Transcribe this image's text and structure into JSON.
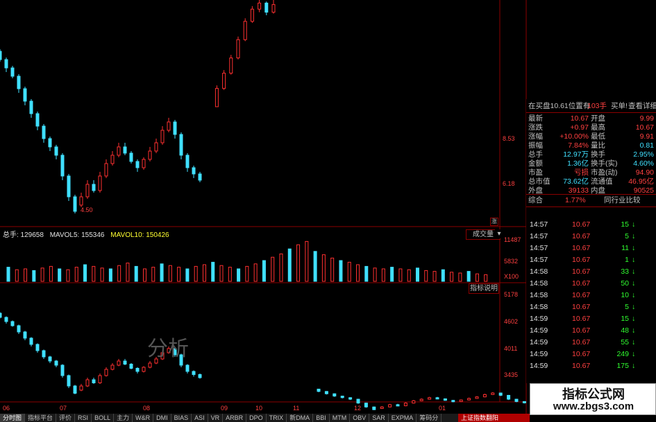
{
  "chart_data": {
    "type": "candlestick",
    "price_ticks": [
      "8.53",
      "6.18"
    ],
    "price_low_label": "4.50",
    "ind_ticks": [
      "5178",
      "4602",
      "4011",
      "3435"
    ],
    "vol_ticks": [
      "11487",
      "5832",
      "X100"
    ],
    "x_labels": [
      "06",
      "07",
      "08",
      "09",
      "10",
      "11",
      "12",
      "01"
    ],
    "colors": {
      "up": "#ff3030",
      "down": "#40e0ff",
      "ma5": "#ffffff",
      "ma10": "#ffd700",
      "grid": "#8b0000"
    },
    "price_candles": [
      [
        0.11,
        0.8,
        0.82,
        0.79,
        0.85
      ],
      [
        0.13,
        0.82,
        0.85,
        0.81,
        0.87
      ],
      [
        0.16,
        0.85,
        0.88,
        0.84,
        0.9
      ],
      [
        0.19,
        0.88,
        0.86,
        0.85,
        0.89
      ],
      [
        0.22,
        0.86,
        0.82,
        0.8,
        0.87
      ],
      [
        0.25,
        0.82,
        0.78,
        0.77,
        0.83
      ],
      [
        0.28,
        0.78,
        0.74,
        0.72,
        0.79
      ],
      [
        0.31,
        0.74,
        0.7,
        0.69,
        0.75
      ],
      [
        0.34,
        0.7,
        0.64,
        0.62,
        0.71
      ],
      [
        0.37,
        0.64,
        0.58,
        0.56,
        0.65
      ],
      [
        0.4,
        0.58,
        0.52,
        0.5,
        0.59
      ],
      [
        0.43,
        0.52,
        0.46,
        0.44,
        0.53
      ],
      [
        0.46,
        0.46,
        0.4,
        0.38,
        0.47
      ],
      [
        0.49,
        0.4,
        0.36,
        0.34,
        0.41
      ],
      [
        0.52,
        0.36,
        0.32,
        0.3,
        0.37
      ],
      [
        0.55,
        0.32,
        0.22,
        0.2,
        0.33
      ],
      [
        0.58,
        0.22,
        0.12,
        0.1,
        0.23
      ],
      [
        0.61,
        0.12,
        0.05,
        0.04,
        0.13
      ],
      [
        0.64,
        0.08,
        0.12,
        0.07,
        0.14
      ],
      [
        0.67,
        0.12,
        0.18,
        0.11,
        0.2
      ],
      [
        0.7,
        0.18,
        0.15,
        0.14,
        0.2
      ],
      [
        0.73,
        0.15,
        0.22,
        0.14,
        0.24
      ],
      [
        0.76,
        0.22,
        0.28,
        0.21,
        0.3
      ],
      [
        0.79,
        0.28,
        0.32,
        0.27,
        0.34
      ],
      [
        0.82,
        0.32,
        0.36,
        0.31,
        0.38
      ],
      [
        0.85,
        0.36,
        0.33,
        0.32,
        0.38
      ],
      [
        0.88,
        0.33,
        0.29,
        0.28,
        0.34
      ],
      [
        0.91,
        0.29,
        0.26,
        0.24,
        0.3
      ],
      [
        0.94,
        0.26,
        0.3,
        0.25,
        0.31
      ],
      [
        0.97,
        0.3,
        0.34,
        0.29,
        0.36
      ],
      [
        1.0,
        0.34,
        0.38,
        0.33,
        0.4
      ],
      [
        1.03,
        0.38,
        0.44,
        0.37,
        0.46
      ],
      [
        1.06,
        0.44,
        0.48,
        0.43,
        0.5
      ],
      [
        1.09,
        0.48,
        0.42,
        0.4,
        0.49
      ],
      [
        1.12,
        0.42,
        0.32,
        0.3,
        0.43
      ],
      [
        1.15,
        0.32,
        0.26,
        0.24,
        0.33
      ],
      [
        1.18,
        0.26,
        0.23,
        0.21,
        0.27
      ],
      [
        1.21,
        0.23,
        0.2,
        0.19,
        0.24
      ]
    ],
    "tail_candles": [
      [
        1.36,
        0.3,
        0.42,
        0.3,
        0.44
      ],
      [
        1.39,
        0.42,
        0.52,
        0.41,
        0.54
      ],
      [
        1.42,
        0.52,
        0.62,
        0.51,
        0.64
      ],
      [
        1.45,
        0.62,
        0.74,
        0.61,
        0.76
      ],
      [
        1.48,
        0.74,
        0.86,
        0.73,
        0.88
      ],
      [
        1.51,
        0.86,
        0.94,
        0.85,
        0.96
      ],
      [
        1.54,
        0.94,
        0.98,
        0.92,
        1.0
      ],
      [
        1.57,
        0.98,
        0.92,
        0.9,
        0.99
      ],
      [
        1.6,
        0.92,
        0.97,
        0.91,
        1.0
      ]
    ],
    "volume_bars": [
      0.34,
      0.28,
      0.3,
      0.26,
      0.32,
      0.36,
      0.3,
      0.28,
      0.34,
      0.4,
      0.36,
      0.32,
      0.3,
      0.38,
      0.44,
      0.36,
      0.3,
      0.34,
      0.42,
      0.38,
      0.34,
      0.3,
      0.36,
      0.4,
      0.46,
      0.38,
      0.34,
      0.3,
      0.36,
      0.42,
      0.5,
      0.58,
      0.66,
      0.78,
      0.88,
      0.96,
      0.72,
      0.64,
      0.56,
      0.5,
      0.46,
      0.4,
      0.36,
      0.32,
      0.3,
      0.34,
      0.3,
      0.28,
      0.32,
      0.26,
      0.24,
      0.28,
      0.22,
      0.2,
      0.24,
      0.18,
      0.16
    ]
  },
  "volume_header": {
    "total": "总手: 129658",
    "ma5": "MAVOL5: 155346",
    "ma10": "MAVOL10: 150426"
  },
  "chart_buttons": {
    "volume": "成交量",
    "indicator": "指标说明",
    "rise_flag": "涨"
  },
  "watermark": "分析",
  "quote_panel": {
    "header": {
      "bid": "在买盘10.61位置有",
      "qty": "103手",
      "buy1": "买单!",
      "detail": "查看详细"
    },
    "rows": [
      {
        "l1": "最新",
        "v1": "10.67",
        "l2": "开盘",
        "v2": "9.99"
      },
      {
        "l1": "涨跌",
        "v1": "+0.97",
        "l2": "最高",
        "v2": "10.67"
      },
      {
        "l1": "涨幅",
        "v1": "+10.00%",
        "l2": "最低",
        "v2": "9.91"
      },
      {
        "l1": "振幅",
        "v1": "7.84%",
        "l2": "量比",
        "v2": "0.81"
      },
      {
        "l1": "总手",
        "v1": "12.97万",
        "l2": "换手",
        "v2": "2.95%"
      },
      {
        "l1": "金额",
        "v1": "1.36亿",
        "l2": "换手(实)",
        "v2": "4.60%"
      },
      {
        "l1": "市盈",
        "v1": "亏损",
        "l2": "市盈(动)",
        "v2": "94.90"
      },
      {
        "l1": "总市值",
        "v1": "73.62亿",
        "l2": "流通值",
        "v2": "46.95亿"
      },
      {
        "l1": "外盘",
        "v1": "39133",
        "l2": "内盘",
        "v2": "90525"
      }
    ],
    "summary": {
      "label": "综合",
      "value": "1.77%",
      "compare": "同行业比较"
    },
    "trades": [
      {
        "time": "14:57",
        "price": "10.67",
        "vol": "15",
        "dir": "↓"
      },
      {
        "time": "14:57",
        "price": "10.67",
        "vol": "5",
        "dir": "↓"
      },
      {
        "time": "14:57",
        "price": "10.67",
        "vol": "11",
        "dir": "↓"
      },
      {
        "time": "14:57",
        "price": "10.67",
        "vol": "1",
        "dir": "↓"
      },
      {
        "time": "14:58",
        "price": "10.67",
        "vol": "33",
        "dir": "↓"
      },
      {
        "time": "14:58",
        "price": "10.67",
        "vol": "50",
        "dir": "↓"
      },
      {
        "time": "14:58",
        "price": "10.67",
        "vol": "10",
        "dir": "↓"
      },
      {
        "time": "14:58",
        "price": "10.67",
        "vol": "5",
        "dir": "↓"
      },
      {
        "time": "14:59",
        "price": "10.67",
        "vol": "15",
        "dir": "↓"
      },
      {
        "time": "14:59",
        "price": "10.67",
        "vol": "48",
        "dir": "↓"
      },
      {
        "time": "14:59",
        "price": "10.67",
        "vol": "55",
        "dir": "↓"
      },
      {
        "time": "14:59",
        "price": "10.67",
        "vol": "249",
        "dir": "↓"
      },
      {
        "time": "14:59",
        "price": "10.67",
        "vol": "175",
        "dir": "↓"
      }
    ]
  },
  "logo": {
    "title": "指标公式网",
    "url": "www.zbgs3.com"
  },
  "bottom_tabs": [
    "分时图",
    "指标平台",
    "评价",
    "RSI",
    "BOLL",
    "主力",
    "W&R",
    "DMI",
    "BIAS",
    "ASI",
    "VR",
    "ARBR",
    "DPO",
    "TRIX",
    "新DMA",
    "BBI",
    "MTM",
    "OBV",
    "SAR",
    "EXPMA",
    "筹码分"
  ],
  "ticker": "上证指数翻阳"
}
